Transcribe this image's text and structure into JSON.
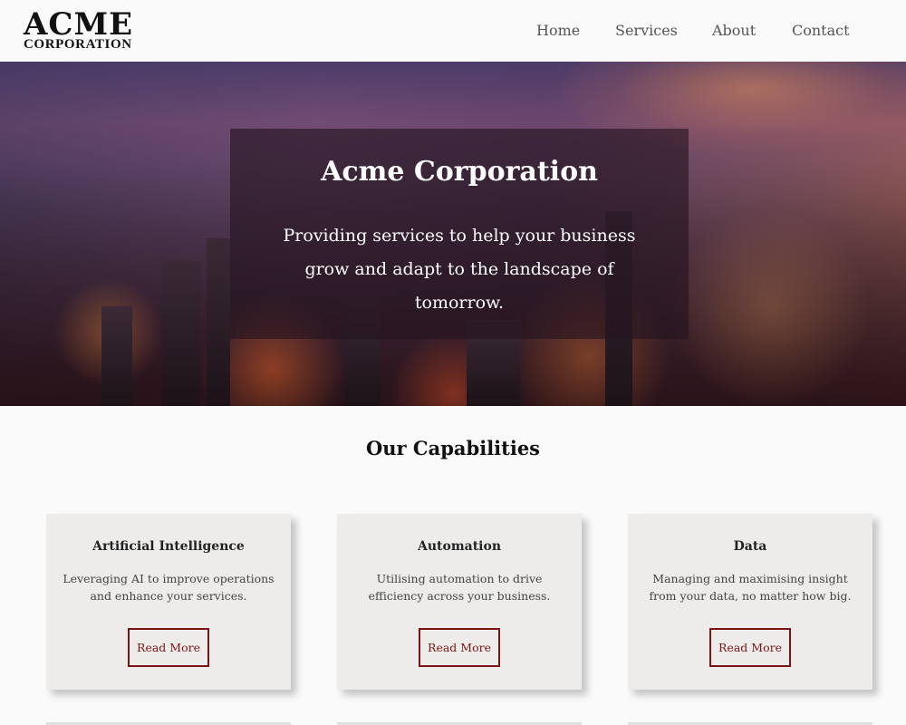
{
  "header": {
    "logo_main": "ACME",
    "logo_sub": "CORPORATION",
    "nav": [
      "Home",
      "Services",
      "About",
      "Contact"
    ]
  },
  "hero": {
    "title": "Acme Corporation",
    "text": "Providing services to help your business grow and adapt to the landscape of tomorrow."
  },
  "capabilities": {
    "title": "Our Capabilities",
    "cards": [
      {
        "title": "Artificial Intelligence",
        "text": "Leveraging AI to improve operations and enhance your services.",
        "button": "Read More"
      },
      {
        "title": "Automation",
        "text": "Utilising automation to drive efficiency across your business.",
        "button": "Read More"
      },
      {
        "title": "Data",
        "text": "Managing and maximising insight from your data, no matter how big.",
        "button": "Read More"
      }
    ]
  },
  "colors": {
    "accent": "#7a1414",
    "card_bg": "#edecea",
    "page_bg": "#fafafa"
  }
}
